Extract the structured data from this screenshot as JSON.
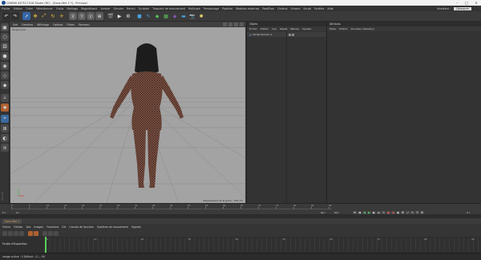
{
  "window": {
    "title": "CINEMA 4D R17.016 Studio (RC) - [Sans titre 1 *] - Principal",
    "controls": [
      "–",
      "□",
      "✕"
    ]
  },
  "menubar": {
    "items": [
      "Fichier",
      "Edition",
      "Créer",
      "Sélectionner",
      "Outils",
      "Maillage",
      "Magnétiseur",
      "Animer",
      "Simuler",
      "Rendu",
      "Sculpter",
      "Traqueur de mouvement",
      "MoGraph",
      "Personnage",
      "Pipeline",
      "Modules externes",
      "RealFlow",
      "Cinéma",
      "Octane",
      "Script",
      "Fenêtre",
      "Aide"
    ],
    "layout_label": "Interface :",
    "layout_value": "Démarrer"
  },
  "toolbar": {
    "icons": [
      "undo-icon",
      "redo-icon",
      "live-select-icon",
      "move-icon",
      "scale-icon",
      "rotate-icon",
      "last-tool-icon",
      "x-axis-icon",
      "y-axis-icon",
      "z-axis-icon",
      "world-icon",
      "render-view-icon",
      "render-picture-viewer-icon",
      "render-settings-icon",
      "cube-icon",
      "pen-icon",
      "subdivision-icon",
      "array-icon",
      "deformer-icon",
      "floor-icon",
      "camera-icon",
      "light-icon"
    ]
  },
  "viewport": {
    "menu": [
      "Vue",
      "Caméras",
      "Affichage",
      "Options",
      "Filtres",
      "Panneau"
    ],
    "camera_label": "Perspective",
    "grid_note": "Espacement de la grille : 100 cm",
    "colors": {
      "bg": "#a3a3a3",
      "mesh": "#3a2520",
      "skin": "#8a5a48"
    }
  },
  "objects_panel": {
    "tab": "Objets",
    "menu": [
      "Fichier",
      "Edition",
      "Vue",
      "Objets",
      "Balises",
      "Signets"
    ],
    "rows": [
      {
        "name": "Model Women 1"
      }
    ]
  },
  "attributes_panel": {
    "tab": "Attributs",
    "menu": [
      "Mode",
      "Edition",
      "Données utilisateur"
    ]
  },
  "timeline": {
    "ticks": [
      "0",
      "5",
      "10",
      "15",
      "20",
      "25",
      "30",
      "35",
      "40",
      "45",
      "50",
      "55",
      "60",
      "65",
      "70",
      "75",
      "80",
      "85",
      "90"
    ],
    "start_frame": "0 I",
    "current_left": "0 I",
    "end_frame": "90 I",
    "end_frame_right": "90 I",
    "current_frame": "0 I"
  },
  "tracker": {
    "tab": "Sans titre 1",
    "menu": [
      "Fichier",
      "Edition",
      "Vue",
      "Images",
      "Fonctions",
      "Clé",
      "Courbe de fonction",
      "Système de mouvement",
      "Signets"
    ],
    "row_label": "Feuille d'Exposition",
    "frame_numbers": [
      "0",
      "10",
      "20",
      "30",
      "40",
      "50",
      "60",
      "70",
      "80",
      "90"
    ]
  },
  "status": {
    "text": "Image active : 0  Défault : 0 — 90"
  }
}
